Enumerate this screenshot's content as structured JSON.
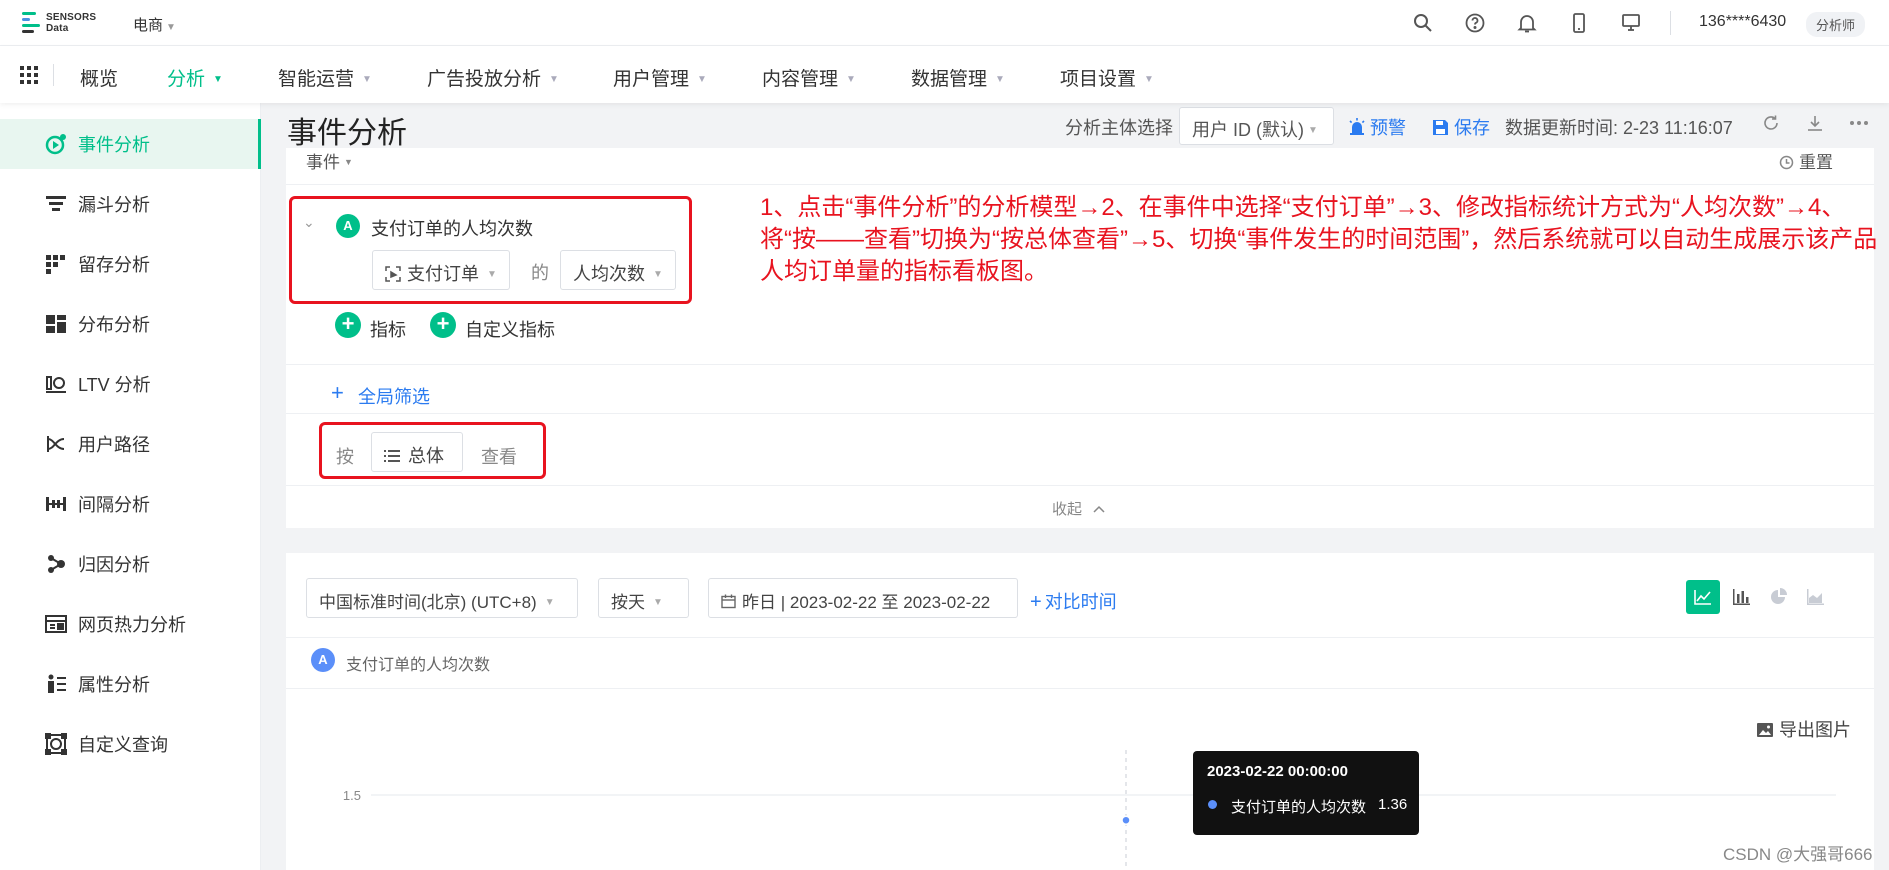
{
  "brand": {
    "line1": "SENSORS",
    "line2": "Data",
    "logo_colors": [
      "#00bf8a",
      "#4a90e2",
      "#333333"
    ]
  },
  "topbar": {
    "project": "电商",
    "icons": [
      "search-icon",
      "help-icon",
      "bell-icon",
      "mobile-icon",
      "monitor-icon"
    ],
    "user": "136****6430",
    "role": "分析师"
  },
  "nav": {
    "items": [
      {
        "label": "概览",
        "has_caret": false,
        "active": false
      },
      {
        "label": "分析",
        "has_caret": true,
        "active": true
      },
      {
        "label": "智能运营",
        "has_caret": true,
        "active": false
      },
      {
        "label": "广告投放分析",
        "has_caret": true,
        "active": false
      },
      {
        "label": "用户管理",
        "has_caret": true,
        "active": false
      },
      {
        "label": "内容管理",
        "has_caret": true,
        "active": false
      },
      {
        "label": "数据管理",
        "has_caret": true,
        "active": false
      },
      {
        "label": "项目设置",
        "has_caret": true,
        "active": false
      }
    ]
  },
  "sidebar": {
    "items": [
      {
        "label": "事件分析",
        "icon": "event-analysis-icon",
        "active": true
      },
      {
        "label": "漏斗分析",
        "icon": "funnel-icon",
        "active": false
      },
      {
        "label": "留存分析",
        "icon": "retention-icon",
        "active": false
      },
      {
        "label": "分布分析",
        "icon": "distribution-icon",
        "active": false
      },
      {
        "label": "LTV 分析",
        "icon": "ltv-icon",
        "active": false
      },
      {
        "label": "用户路径",
        "icon": "user-path-icon",
        "active": false
      },
      {
        "label": "间隔分析",
        "icon": "interval-icon",
        "active": false
      },
      {
        "label": "归因分析",
        "icon": "attribution-icon",
        "active": false
      },
      {
        "label": "网页热力分析",
        "icon": "heatmap-icon",
        "active": false
      },
      {
        "label": "属性分析",
        "icon": "attribute-icon",
        "active": false
      },
      {
        "label": "自定义查询",
        "icon": "custom-query-icon",
        "active": false
      }
    ]
  },
  "header": {
    "title": "事件分析",
    "subject_label": "分析主体选择",
    "subject_value": "用户 ID (默认)",
    "alert": "预警",
    "save": "保存",
    "update_time": "数据更新时间: 2-23 11:16:07"
  },
  "query": {
    "events_label": "事件",
    "reset": "重置",
    "metric_badge": "A",
    "metric_name": "支付订单的人均次数",
    "event_select": "支付订单",
    "connector": "的",
    "stat_select": "人均次数",
    "add_metric": "指标",
    "add_custom_metric": "自定义指标",
    "global_filter": "全局筛选",
    "group_by_prefix": "按",
    "group_by_value": "总体",
    "group_by_suffix": "查看",
    "collapse": "收起"
  },
  "instructions": "1、点击“事件分析”的分析模型→2、在事件中选择“支付订单”→3、修改指标统计方式为“人均次数”→4、将“按——查看”切换为“按总体查看”→5、切换“事件发生的时间范围”，然后系统就可以自动生成展示该产品人均订单量的指标看板图。",
  "chart_controls": {
    "timezone": "中国标准时间(北京) (UTC+8)",
    "granularity": "按天",
    "date_range": "昨日 | 2023-02-22 至 2023-02-22",
    "compare": "对比时间",
    "chart_types": [
      "line-chart-icon",
      "bar-chart-icon",
      "pie-chart-icon",
      "area-chart-icon"
    ],
    "legend_badge": "A",
    "legend_label": "支付订单的人均次数",
    "export": "导出图片"
  },
  "tooltip": {
    "title": "2023-02-22 00:00:00",
    "series": "支付订单的人均次数",
    "value": "1.36"
  },
  "chart_data": {
    "type": "line",
    "x": [
      "2023-02-22"
    ],
    "series": [
      {
        "name": "支付订单的人均次数",
        "values": [
          1.36
        ]
      }
    ],
    "y_ticks": [
      "1.5"
    ],
    "ylim": [
      1.0,
      1.5
    ],
    "grid": true,
    "tooltip_visible": true
  },
  "watermark": "CSDN @大强哥666",
  "colors": {
    "accent": "#00bf8a",
    "link": "#2b7bf0",
    "annotation": "#e8131f",
    "point": "#5b8ff9"
  }
}
